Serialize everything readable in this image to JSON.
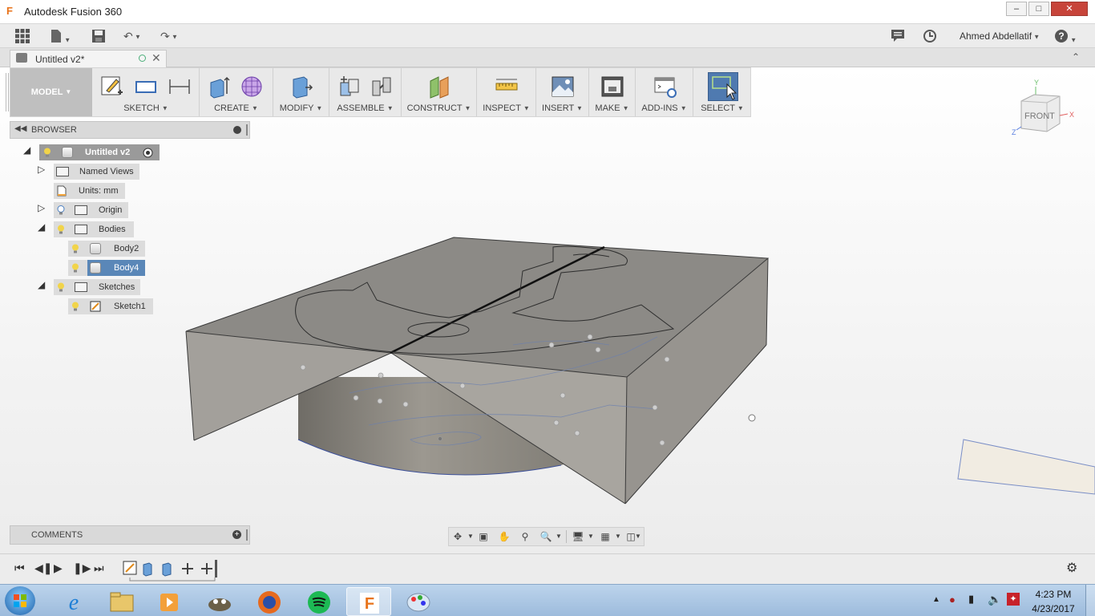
{
  "window": {
    "title": "Autodesk Fusion 360",
    "app_icon_letter": "F"
  },
  "qat": {
    "user_name": "Ahmed Abdellatif"
  },
  "tab": {
    "label": "Untitled v2*"
  },
  "ribbon": {
    "workspace": "MODEL",
    "groups": [
      {
        "label": "SKETCH"
      },
      {
        "label": "CREATE"
      },
      {
        "label": "MODIFY"
      },
      {
        "label": "ASSEMBLE"
      },
      {
        "label": "CONSTRUCT"
      },
      {
        "label": "INSPECT"
      },
      {
        "label": "INSERT"
      },
      {
        "label": "MAKE"
      },
      {
        "label": "ADD-INS"
      },
      {
        "label": "SELECT"
      }
    ]
  },
  "browser": {
    "title": "BROWSER",
    "root": "Untitled v2",
    "named_views": "Named Views",
    "units": "Units: mm",
    "origin": "Origin",
    "bodies": "Bodies",
    "body2": "Body2",
    "body4": "Body4",
    "sketches": "Sketches",
    "sketch1": "Sketch1"
  },
  "comments": {
    "title": "COMMENTS"
  },
  "viewcube": {
    "face": "FRONT",
    "axis_x": "X",
    "axis_y": "Y",
    "axis_z": "Z"
  },
  "taskbar": {
    "time": "4:23 PM",
    "date": "4/23/2017"
  }
}
